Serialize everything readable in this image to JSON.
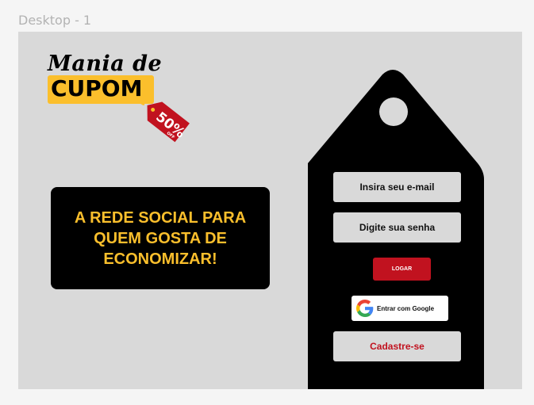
{
  "frame": {
    "label": "Desktop - 1"
  },
  "logo": {
    "title": "Mania de",
    "highlight": "CUPOM",
    "tag_percent": "50%",
    "tag_off": "OFF"
  },
  "slogan": {
    "text": "A REDE SOCIAL PARA QUEM GOSTA DE ECONOMIZAR!"
  },
  "login": {
    "email_placeholder": "Insira seu e-mail",
    "password_placeholder": "Digite sua senha",
    "login_button": "LOGAR",
    "google_button": "Entrar com Google",
    "signup_button": "Cadastre-se"
  },
  "colors": {
    "accent_yellow": "#fbbf2c",
    "accent_red": "#c1121f",
    "panel_black": "#000000",
    "canvas_gray": "#d9d9d9"
  }
}
